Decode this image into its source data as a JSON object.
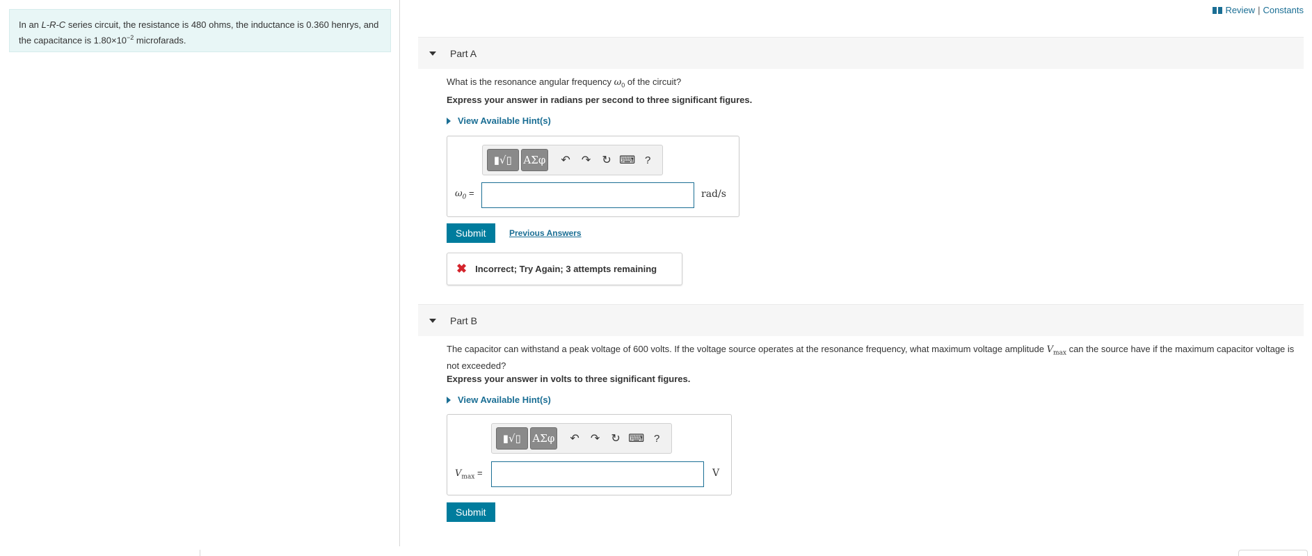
{
  "statement": {
    "prefix": "In an ",
    "circuit": "L-R-C",
    "middle": " series circuit, the resistance is 480 ohms, the inductance is 0.360 henrys, and the capacitance is 1.80×10",
    "exponent": "−2",
    "suffix": " microfarads."
  },
  "top_links": {
    "review": "Review",
    "separator": "|",
    "constants": "Constants"
  },
  "toolbar": {
    "template_label": "▮√▯",
    "greek_label": "ΑΣφ",
    "undo": "↶",
    "redo": "↷",
    "reset": "↻",
    "keyboard": "⌨",
    "help": "?"
  },
  "part_a": {
    "title": "Part A",
    "question_before": "What is the resonance angular frequency ",
    "question_var": "ω",
    "question_sub": "0",
    "question_after": " of the circuit?",
    "instruction": "Express your answer in radians per second to three significant figures.",
    "hint": "View Available Hint(s)",
    "var_label": "ω",
    "var_sub": "0",
    "eq": " =",
    "input_value": "",
    "unit": "rad/s",
    "submit": "Submit",
    "previous": "Previous Answers",
    "feedback": "Incorrect; Try Again; 3 attempts remaining"
  },
  "part_b": {
    "title": "Part B",
    "question_before": "The capacitor can withstand a peak voltage of 600 volts. If the voltage source operates at the resonance frequency, what maximum voltage amplitude ",
    "question_var": "V",
    "question_sub": "max",
    "question_after": " can the source have if the maximum capacitor voltage is not exceeded?",
    "instruction": "Express your answer in volts to three significant figures.",
    "hint": "View Available Hint(s)",
    "var_label": "V",
    "var_sub": "max",
    "eq": " =",
    "input_value": "",
    "unit": "V",
    "submit": "Submit"
  },
  "colors": {
    "accent": "#007c9d",
    "link": "#1a6e94",
    "error": "#d4242c",
    "statement_bg": "#e8f6f6"
  }
}
